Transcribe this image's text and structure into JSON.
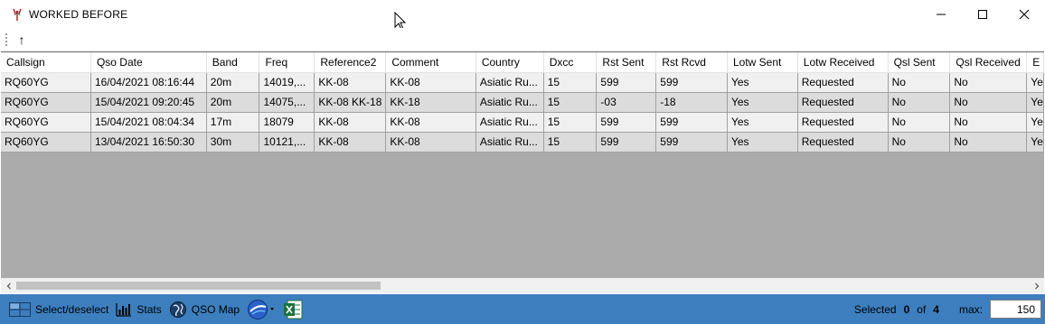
{
  "window": {
    "title": "WORKED BEFORE"
  },
  "toolbar": {
    "up_label": "↑"
  },
  "table": {
    "columns": [
      "Callsign",
      "Qso Date",
      "Band",
      "Freq",
      "Reference2",
      "Comment",
      "Country",
      "Dxcc",
      "Rst Sent",
      "Rst Rcvd",
      "Lotw Sent",
      "Lotw Received",
      "Qsl Sent",
      "Qsl Received",
      "E"
    ],
    "rows": [
      [
        "RQ60YG",
        "16/04/2021 08:16:44",
        "20m",
        "14019,...",
        "KK-08",
        "KK-08",
        "Asiatic Ru...",
        "15",
        "599",
        "599",
        "Yes",
        "Requested",
        "No",
        "No",
        "Ye"
      ],
      [
        "RQ60YG",
        "15/04/2021 09:20:45",
        "20m",
        "14075,...",
        "KK-08 KK-18",
        "KK-18",
        "Asiatic Ru...",
        "15",
        "-03",
        "-18",
        "Yes",
        "Requested",
        "No",
        "No",
        "Ye"
      ],
      [
        "RQ60YG",
        "15/04/2021 08:04:34",
        "17m",
        "18079",
        "KK-08",
        "KK-08",
        "Asiatic Ru...",
        "15",
        "599",
        "599",
        "Yes",
        "Requested",
        "No",
        "No",
        "Ye"
      ],
      [
        "RQ60YG",
        "13/04/2021 16:50:30",
        "30m",
        "10121,...",
        "KK-08",
        "KK-08",
        "Asiatic Ru...",
        "15",
        "599",
        "599",
        "Yes",
        "Requested",
        "No",
        "No",
        "Ye"
      ]
    ]
  },
  "statusbar": {
    "select_label": "Select/deselect",
    "stats_label": "Stats",
    "map_label": "QSO Map",
    "selected_label": "Selected",
    "selected_count": "0",
    "of_label": "of",
    "total_count": "4",
    "max_label": "max:",
    "max_value": "150"
  },
  "colors": {
    "statusbar_bg": "#3d7fbe",
    "grid_bg": "#ababab",
    "row_even": "#f0f0f0",
    "row_odd": "#dcdcdc"
  },
  "icons": {
    "app": "app-antenna-icon",
    "select": "select-grid-icon",
    "stats": "bar-chart-icon",
    "map": "globe-icon",
    "earth": "google-earth-icon",
    "excel": "excel-icon"
  }
}
